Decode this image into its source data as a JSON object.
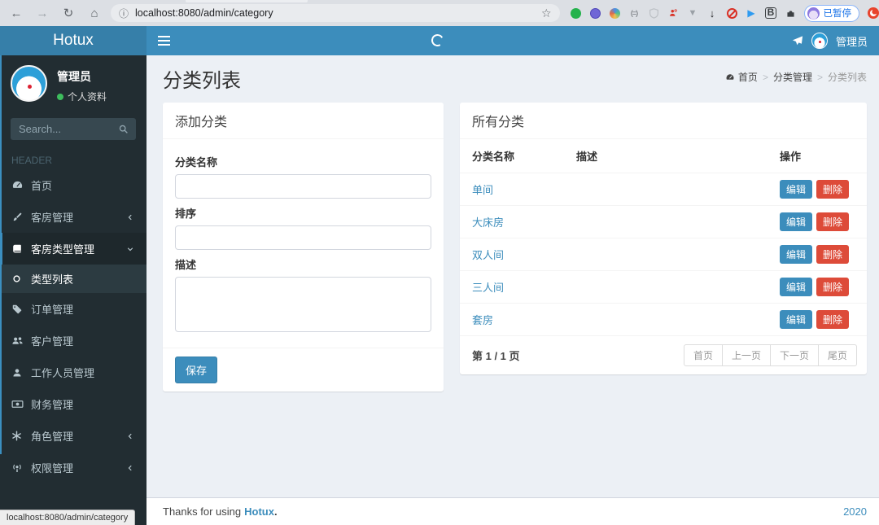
{
  "colors": {
    "primary": "#3c8dbc",
    "primary_dark": "#367fa9",
    "danger": "#dd4b39",
    "success": "#3dbd5d",
    "sidebar_bg": "#222d32",
    "content_bg": "#ecf0f5"
  },
  "browser": {
    "url": "localhost:8080/admin/category",
    "paused_label": "已暂停"
  },
  "topbar": {
    "brand": "Hotux",
    "user_name": "管理员"
  },
  "sidebar": {
    "user_name": "管理员",
    "user_status": "个人资料",
    "search_placeholder": "Search...",
    "section_label": "HEADER",
    "items": [
      {
        "label": "首页",
        "icon": "dashboard-icon"
      },
      {
        "label": "客房管理",
        "icon": "brush-icon",
        "chevron": "left"
      },
      {
        "label": "客房类型管理",
        "icon": "book-icon",
        "chevron": "down",
        "active": true
      },
      {
        "label": "类型列表",
        "icon": "circle-o-icon",
        "submenu": true,
        "active": true
      },
      {
        "label": "订单管理",
        "icon": "tag-icon"
      },
      {
        "label": "客户管理",
        "icon": "users-icon"
      },
      {
        "label": "工作人员管理",
        "icon": "user-icon"
      },
      {
        "label": "财务管理",
        "icon": "money-icon"
      },
      {
        "label": "角色管理",
        "icon": "asterisk-icon",
        "chevron": "left"
      },
      {
        "label": "权限管理",
        "icon": "podcast-icon",
        "chevron": "left"
      }
    ]
  },
  "page": {
    "title": "分类列表",
    "breadcrumb_home": "首页",
    "breadcrumb_mid": "分类管理",
    "breadcrumb_current": "分类列表"
  },
  "add_form": {
    "title": "添加分类",
    "name_label": "分类名称",
    "sort_label": "排序",
    "desc_label": "描述",
    "save_label": "保存"
  },
  "category_table": {
    "title": "所有分类",
    "col_name": "分类名称",
    "col_desc": "描述",
    "col_ops": "操作",
    "rows": [
      {
        "name": "单间",
        "desc": ""
      },
      {
        "name": "大床房",
        "desc": ""
      },
      {
        "name": "双人间",
        "desc": ""
      },
      {
        "name": "三人间",
        "desc": ""
      },
      {
        "name": "套房",
        "desc": ""
      }
    ],
    "edit_label": "编辑",
    "delete_label": "删除",
    "page_info": "第 1 / 1 页",
    "pagination": [
      {
        "label": "首页"
      },
      {
        "label": "上一页"
      },
      {
        "label": "下一页"
      },
      {
        "label": "尾页"
      }
    ]
  },
  "footer": {
    "prefix": "Thanks for using",
    "brand": "Hotux",
    "suffix": ".",
    "year": "2020"
  },
  "statusbar": {
    "url": "localhost:8080/admin/category"
  }
}
